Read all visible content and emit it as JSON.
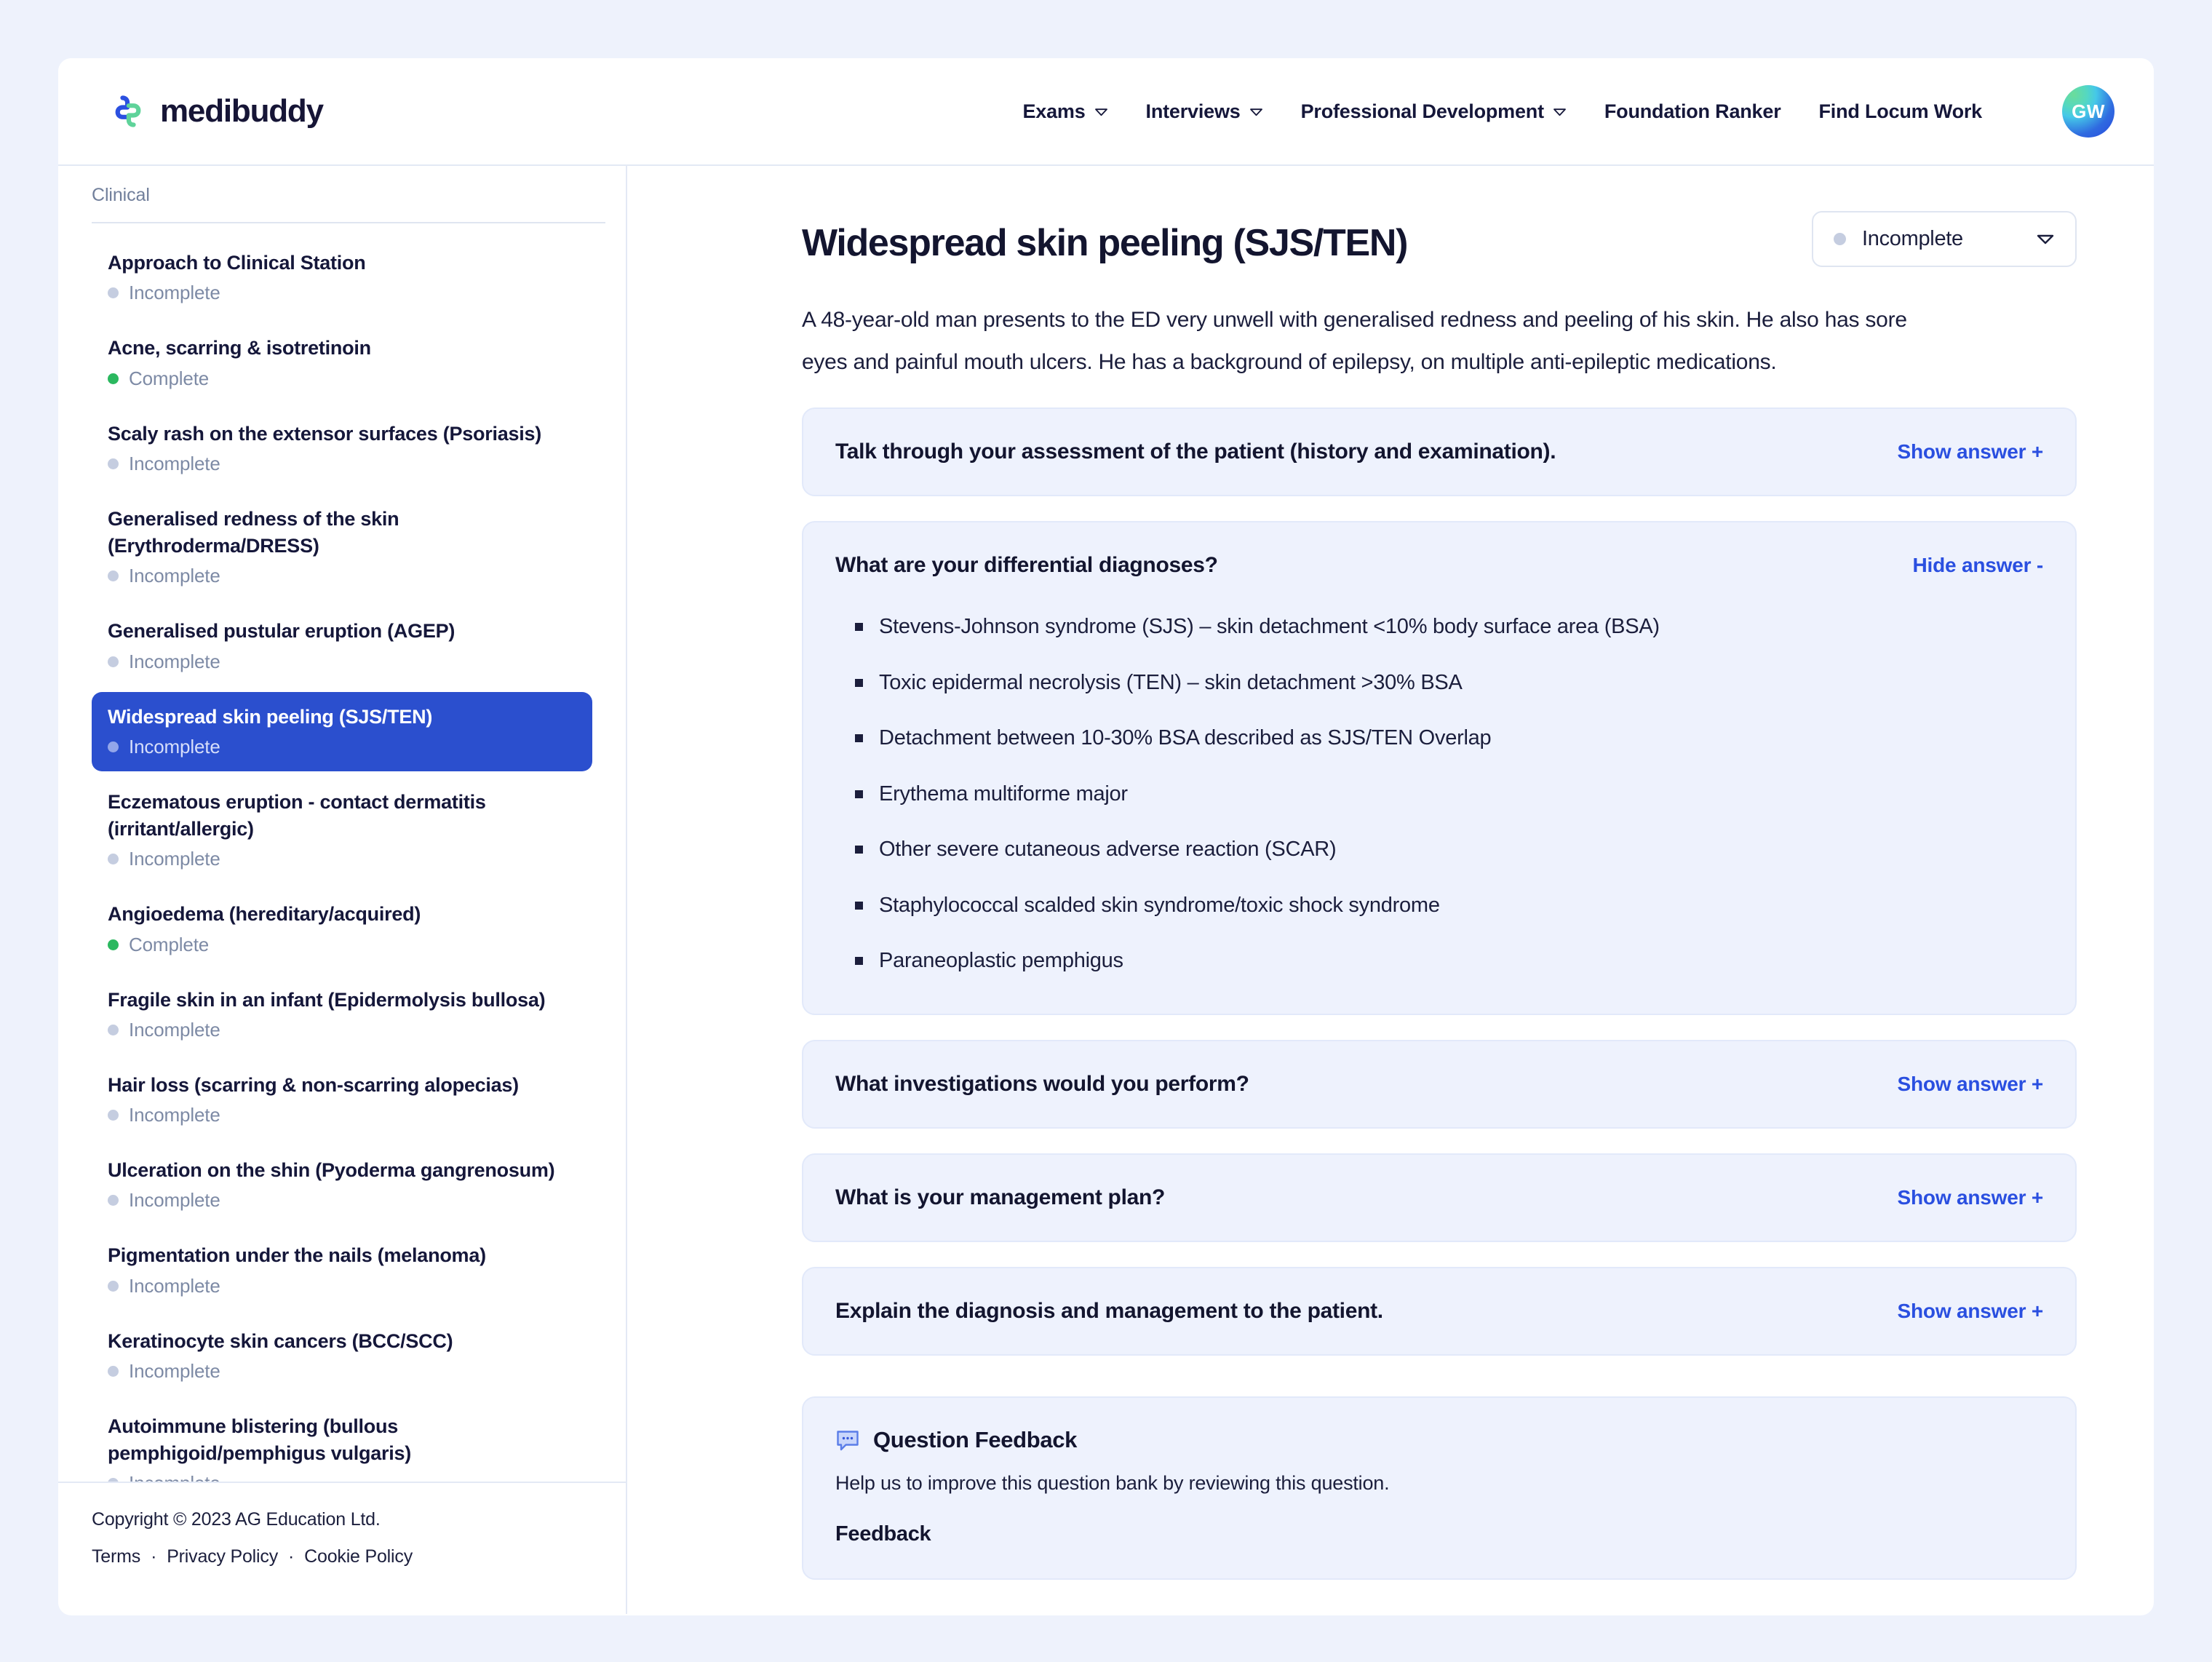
{
  "header": {
    "brand_name": "medibuddy",
    "nav": [
      {
        "label": "Exams",
        "has_dropdown": true
      },
      {
        "label": "Interviews",
        "has_dropdown": true
      },
      {
        "label": "Professional Development",
        "has_dropdown": true
      },
      {
        "label": "Foundation Ranker",
        "has_dropdown": false
      },
      {
        "label": "Find Locum Work",
        "has_dropdown": false
      }
    ],
    "avatar_initials": "GW"
  },
  "sidebar": {
    "section_label": "Clinical",
    "items": [
      {
        "title": "Approach to Clinical Station",
        "status": "Incomplete",
        "complete": false,
        "active": false
      },
      {
        "title": "Acne, scarring & isotretinoin",
        "status": "Complete",
        "complete": true,
        "active": false
      },
      {
        "title": "Scaly rash on the extensor surfaces (Psoriasis)",
        "status": "Incomplete",
        "complete": false,
        "active": false
      },
      {
        "title": "Generalised redness of the skin (Erythroderma/DRESS)",
        "status": "Incomplete",
        "complete": false,
        "active": false
      },
      {
        "title": "Generalised pustular eruption (AGEP)",
        "status": "Incomplete",
        "complete": false,
        "active": false
      },
      {
        "title": "Widespread skin peeling (SJS/TEN)",
        "status": "Incomplete",
        "complete": false,
        "active": true
      },
      {
        "title": "Eczematous eruption - contact dermatitis (irritant/allergic)",
        "status": "Incomplete",
        "complete": false,
        "active": false
      },
      {
        "title": "Angioedema (hereditary/acquired)",
        "status": "Complete",
        "complete": true,
        "active": false
      },
      {
        "title": "Fragile skin in an infant (Epidermolysis bullosa)",
        "status": "Incomplete",
        "complete": false,
        "active": false
      },
      {
        "title": "Hair loss (scarring & non-scarring alopecias)",
        "status": "Incomplete",
        "complete": false,
        "active": false
      },
      {
        "title": "Ulceration on the shin (Pyoderma gangrenosum)",
        "status": "Incomplete",
        "complete": false,
        "active": false
      },
      {
        "title": "Pigmentation under the nails (melanoma)",
        "status": "Incomplete",
        "complete": false,
        "active": false
      },
      {
        "title": "Keratinocyte skin cancers (BCC/SCC)",
        "status": "Incomplete",
        "complete": false,
        "active": false
      },
      {
        "title": "Autoimmune blistering (bullous pemphigoid/pemphigus vulgaris)",
        "status": "Incomplete",
        "complete": false,
        "active": false
      }
    ],
    "footer": {
      "copyright": "Copyright © 2023 AG Education Ltd.",
      "links": [
        "Terms",
        "Privacy Policy",
        "Cookie Policy"
      ],
      "separator": "·"
    }
  },
  "main": {
    "title": "Widespread skin peeling (SJS/TEN)",
    "status_select": {
      "value": "Incomplete",
      "complete": false
    },
    "stem": "A 48-year-old man presents to the ED very unwell with generalised redness and peeling of his skin. He also has sore eyes and painful mouth ulcers. He has a background of epilepsy, on multiple anti-epileptic medications.",
    "questions": [
      {
        "question": "Talk through your assessment of the patient (history and examination).",
        "toggle_label": "Show answer +",
        "expanded": false,
        "answers": []
      },
      {
        "question": "What are your differential diagnoses?",
        "toggle_label": "Hide answer -",
        "expanded": true,
        "answers": [
          "Stevens-Johnson syndrome (SJS) – skin detachment <10% body surface area (BSA)",
          "Toxic epidermal necrolysis (TEN) – skin detachment >30% BSA",
          "Detachment between 10-30% BSA described as SJS/TEN Overlap",
          "Erythema multiforme major",
          "Other severe cutaneous adverse reaction (SCAR)",
          "Staphylococcal scalded skin syndrome/toxic shock syndrome",
          "Paraneoplastic pemphigus"
        ]
      },
      {
        "question": "What investigations would you perform?",
        "toggle_label": "Show answer +",
        "expanded": false,
        "answers": []
      },
      {
        "question": "What is your management plan?",
        "toggle_label": "Show answer +",
        "expanded": false,
        "answers": []
      },
      {
        "question": "Explain the diagnosis and management to the patient.",
        "toggle_label": "Show answer +",
        "expanded": false,
        "answers": []
      }
    ],
    "feedback": {
      "title": "Question Feedback",
      "subtitle": "Help us to improve this question bank by reviewing this question.",
      "field_label": "Feedback"
    }
  },
  "colors": {
    "page_background": "#eef2fc",
    "accent_blue": "#2b4fce",
    "link_blue": "#2a4fe0",
    "complete_green": "#2bb85f",
    "incomplete_grey": "#c5cde0",
    "card_background": "#eef2fd",
    "text_dark": "#13152f",
    "logo_blue": "#2b50e0",
    "logo_green": "#5fd39a"
  }
}
